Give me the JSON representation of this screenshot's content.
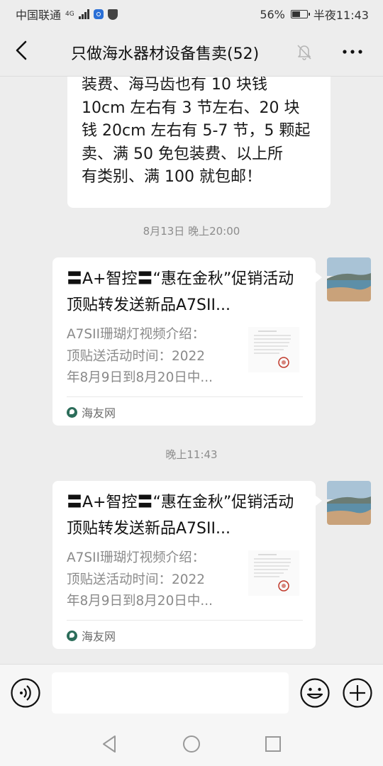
{
  "status_bar": {
    "carrier": "中国联通",
    "network": "4G",
    "battery_percent": "56%",
    "battery_level": 0.56,
    "time": "半夜11:43"
  },
  "header": {
    "title": "只做海水器材设备售卖(52)"
  },
  "messages": {
    "text_bubble": {
      "lines": [
        "装费、海马齿也有 10 块钱",
        "10cm 左右有 3 节左右、20 块",
        "钱 20cm 左右有 5-7 节，5 颗起",
        "卖、满 50 免包装费、以上所",
        "有类别、满 100 就包邮！"
      ]
    },
    "timestamp_1": "8月13日 晚上20:00",
    "card_1": {
      "title": "〓A+智控〓“惠在金秋”促销活动顶贴转发送新品A7SII...",
      "desc_lines": [
        "A7SII珊瑚灯视频介绍：",
        "顶贴送活动时间：2022",
        "年8月9日到8月20日中..."
      ],
      "source": "海友网"
    },
    "timestamp_2": "晚上11:43",
    "card_2": {
      "title": "〓A+智控〓“惠在金秋”促销活动顶贴转发送新品A7SII...",
      "desc_lines": [
        "A7SII珊瑚灯视频介绍：",
        "顶贴送活动时间：2022",
        "年8月9日到8月20日中..."
      ],
      "source": "海友网"
    }
  },
  "input": {
    "value": "",
    "placeholder": ""
  },
  "icons": {
    "back": "back-arrow-icon",
    "mute": "bell-muted-icon",
    "more": "more-dots-icon",
    "voice": "voice-icon",
    "emoji": "emoji-icon",
    "plus": "plus-icon"
  },
  "colors": {
    "background": "#ededed",
    "bubble": "#ffffff",
    "timestamp": "#8c8c8c"
  }
}
